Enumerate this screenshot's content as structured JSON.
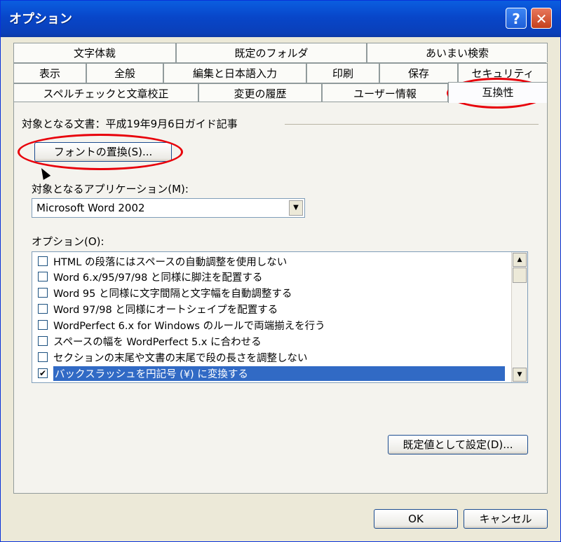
{
  "window": {
    "title": "オプション",
    "help_glyph": "?",
    "close_glyph": "✕"
  },
  "tabs": {
    "row1": [
      "文字体裁",
      "既定のフォルダ",
      "あいまい検索"
    ],
    "row2": [
      "表示",
      "全般",
      "編集と日本語入力",
      "印刷",
      "保存",
      "セキュリティ"
    ],
    "row3": [
      "スペルチェックと文章校正",
      "変更の履歴",
      "ユーザー情報",
      "互換性"
    ],
    "active": "互換性"
  },
  "compat": {
    "target_doc_label": "対象となる文書：平成19年9月6日ガイド記事",
    "font_replace_button": "フォントの置換(S)...",
    "target_app_label": "対象となるアプリケーション(M):",
    "target_app_value": "Microsoft Word 2002",
    "options_label": "オプション(O):",
    "options": [
      {
        "text": "HTML の段落にはスペースの自動調整を使用しない",
        "checked": false,
        "selected": false
      },
      {
        "text": "Word 6.x/95/97/98 と同様に脚注を配置する",
        "checked": false,
        "selected": false
      },
      {
        "text": "Word 95 と同様に文字間隔と文字幅を自動調整する",
        "checked": false,
        "selected": false
      },
      {
        "text": "Word 97/98 と同様にオートシェイプを配置する",
        "checked": false,
        "selected": false
      },
      {
        "text": "WordPerfect 6.x for Windows のルールで両端揃えを行う",
        "checked": false,
        "selected": false
      },
      {
        "text": "スペースの幅を WordPerfect 5.x に合わせる",
        "checked": false,
        "selected": false
      },
      {
        "text": "セクションの末尾や文書の末尾で段の長さを調整しない",
        "checked": false,
        "selected": false
      },
      {
        "text": "バックスラッシュを円記号 (¥) に変換する",
        "checked": true,
        "selected": true
      }
    ],
    "default_button": "既定値として設定(D)..."
  },
  "footer": {
    "ok": "OK",
    "cancel": "キャンセル"
  },
  "colors": {
    "annotation": "#e8000a",
    "selection": "#316ac5",
    "titlebar": "#0846c9"
  }
}
